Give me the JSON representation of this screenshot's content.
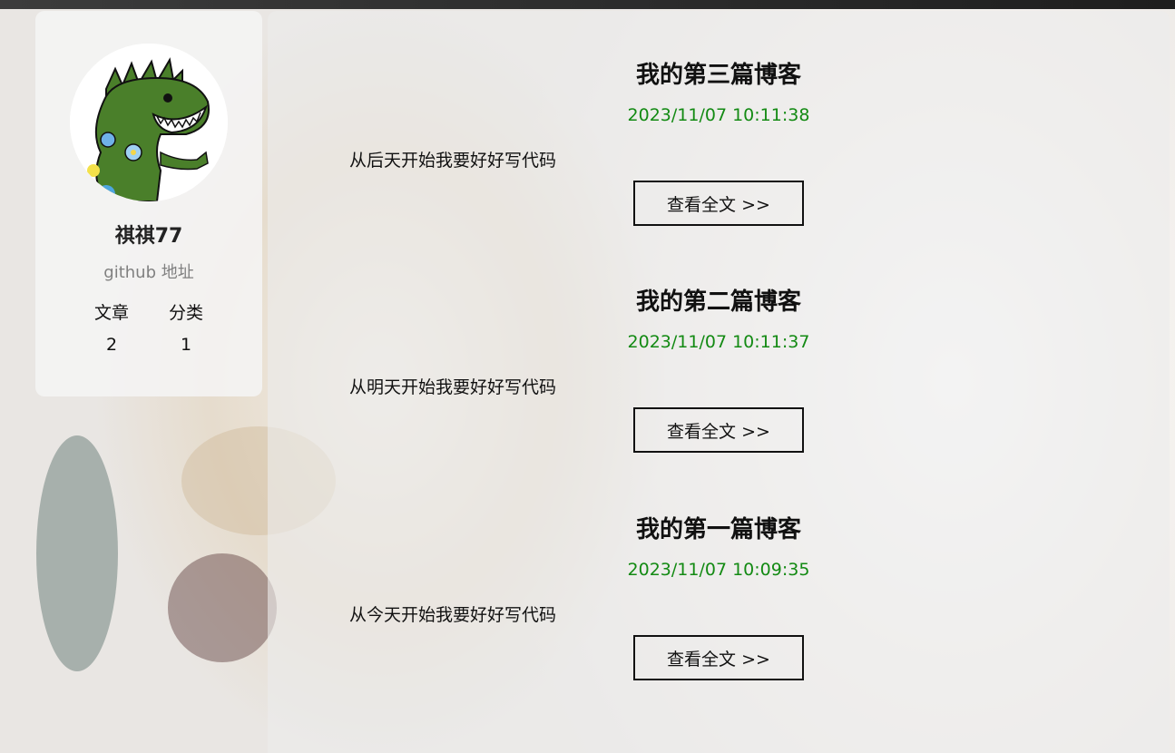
{
  "profile": {
    "username": "祺祺77",
    "github_link": "github 地址",
    "stats": [
      {
        "label": "文章",
        "value": "2"
      },
      {
        "label": "分类",
        "value": "1"
      }
    ]
  },
  "posts": [
    {
      "title": "我的第三篇博客",
      "date": "2023/11/07 10:11:38",
      "summary": "从后天开始我要好好写代码",
      "button_label": "查看全文 >>"
    },
    {
      "title": "我的第二篇博客",
      "date": "2023/11/07 10:11:37",
      "summary": "从明天开始我要好好写代码",
      "button_label": "查看全文 >>"
    },
    {
      "title": "我的第一篇博客",
      "date": "2023/11/07 10:09:35",
      "summary": "从今天开始我要好好写代码",
      "button_label": "查看全文 >>"
    }
  ],
  "colors": {
    "date_green": "#138a13",
    "github_gray": "#808080",
    "avatar_dino": "#4a7f2a"
  }
}
